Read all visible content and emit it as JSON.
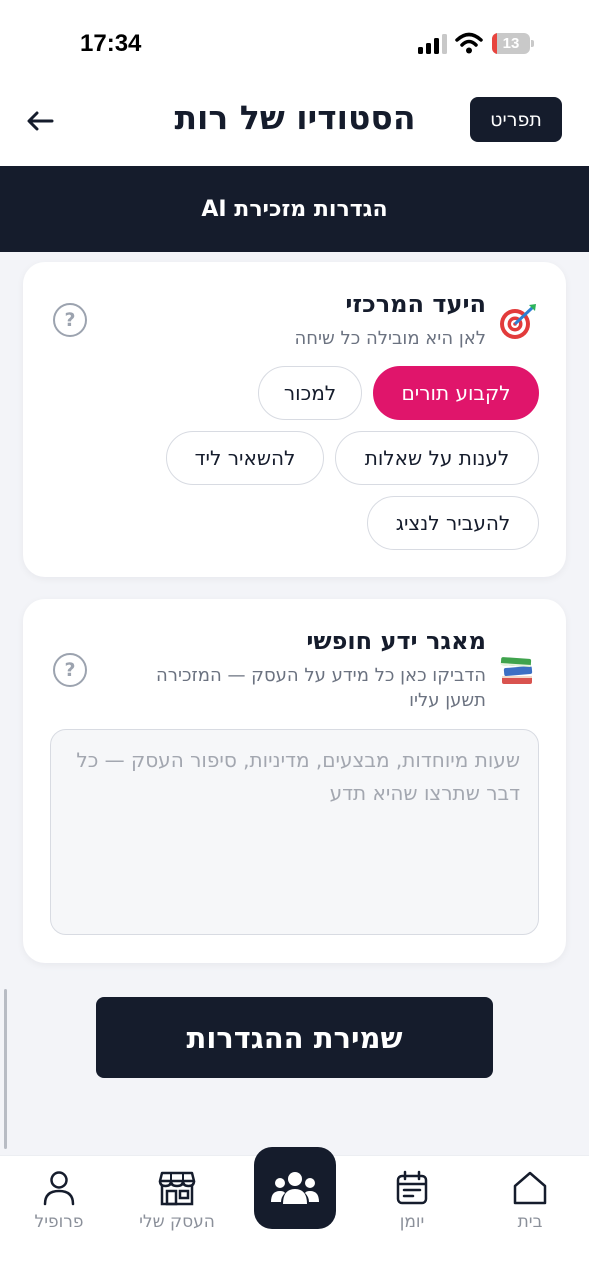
{
  "status_bar": {
    "time": "17:34",
    "battery_level": "13",
    "battery_fraction": 0.13
  },
  "header": {
    "title": "הסטודיו של רות",
    "menu_label": "תפריט",
    "back_icon": "arrow-left-icon"
  },
  "banner": {
    "title": "הגדרות מזכירת AI"
  },
  "goal_card": {
    "icon": "dart-target-icon",
    "title": "היעד המרכזי",
    "subtitle": "לאן היא מובילה כל שיחה",
    "help": "?",
    "options": [
      {
        "label": "לקבוע תורים",
        "selected": true
      },
      {
        "label": "למכור",
        "selected": false
      },
      {
        "label": "לענות על שאלות",
        "selected": false
      },
      {
        "label": "להשאיר ליד",
        "selected": false
      },
      {
        "label": "להעביר לנציג",
        "selected": false
      }
    ]
  },
  "knowledge_card": {
    "icon": "books-icon",
    "title": "מאגר ידע חופשי",
    "subtitle": "הדביקו כאן כל מידע על העסק — המזכירה תשען עליו",
    "help": "?",
    "value": "",
    "placeholder": "שעות מיוחדות, מבצעים, מדיניות, סיפור העסק — כל דבר שתרצו שהיא תדע"
  },
  "save_button": {
    "label": "שמירת ההגדרות"
  },
  "bottom_nav": {
    "items": [
      {
        "label": "פרופיל",
        "icon": "person-icon"
      },
      {
        "label": "העסק שלי",
        "icon": "store-icon"
      },
      {
        "label": "",
        "icon": "group-icon",
        "active": true
      },
      {
        "label": "יומן",
        "icon": "calendar-icon"
      },
      {
        "label": "בית",
        "icon": "home-icon"
      }
    ]
  },
  "colors": {
    "primary_dark": "#151c2c",
    "accent": "#e0156b",
    "background": "#f3f4f8",
    "muted": "#8b909a"
  }
}
